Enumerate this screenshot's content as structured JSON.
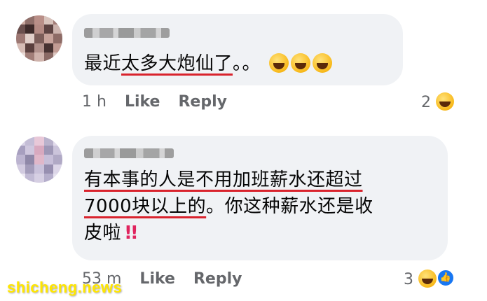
{
  "comments": [
    {
      "text_parts": [
        "最近",
        "太多大炮仙了",
        "。。"
      ],
      "time": "1 h",
      "like_label": "Like",
      "reply_label": "Reply",
      "reaction_count": "2"
    },
    {
      "line1": "有本事的人是不用加班薪水还超过",
      "line2_underlined": "7000块以上的",
      "line2_rest": "。你这种薪水还是收",
      "line3": "皮啦",
      "line3_mark": "!!",
      "time": "53 m",
      "like_label": "Like",
      "reply_label": "Reply",
      "reaction_count": "3"
    }
  ],
  "watermark": "shicheng.news",
  "colors": {
    "bubble": "#f0f2f5",
    "underline": "#d9232d",
    "meta": "#65676b",
    "like_badge": "#1877f2",
    "watermark": "#ffe600"
  },
  "icons": [
    "grinning-sweat-icon",
    "laughing-icon",
    "like-thumb-icon"
  ]
}
